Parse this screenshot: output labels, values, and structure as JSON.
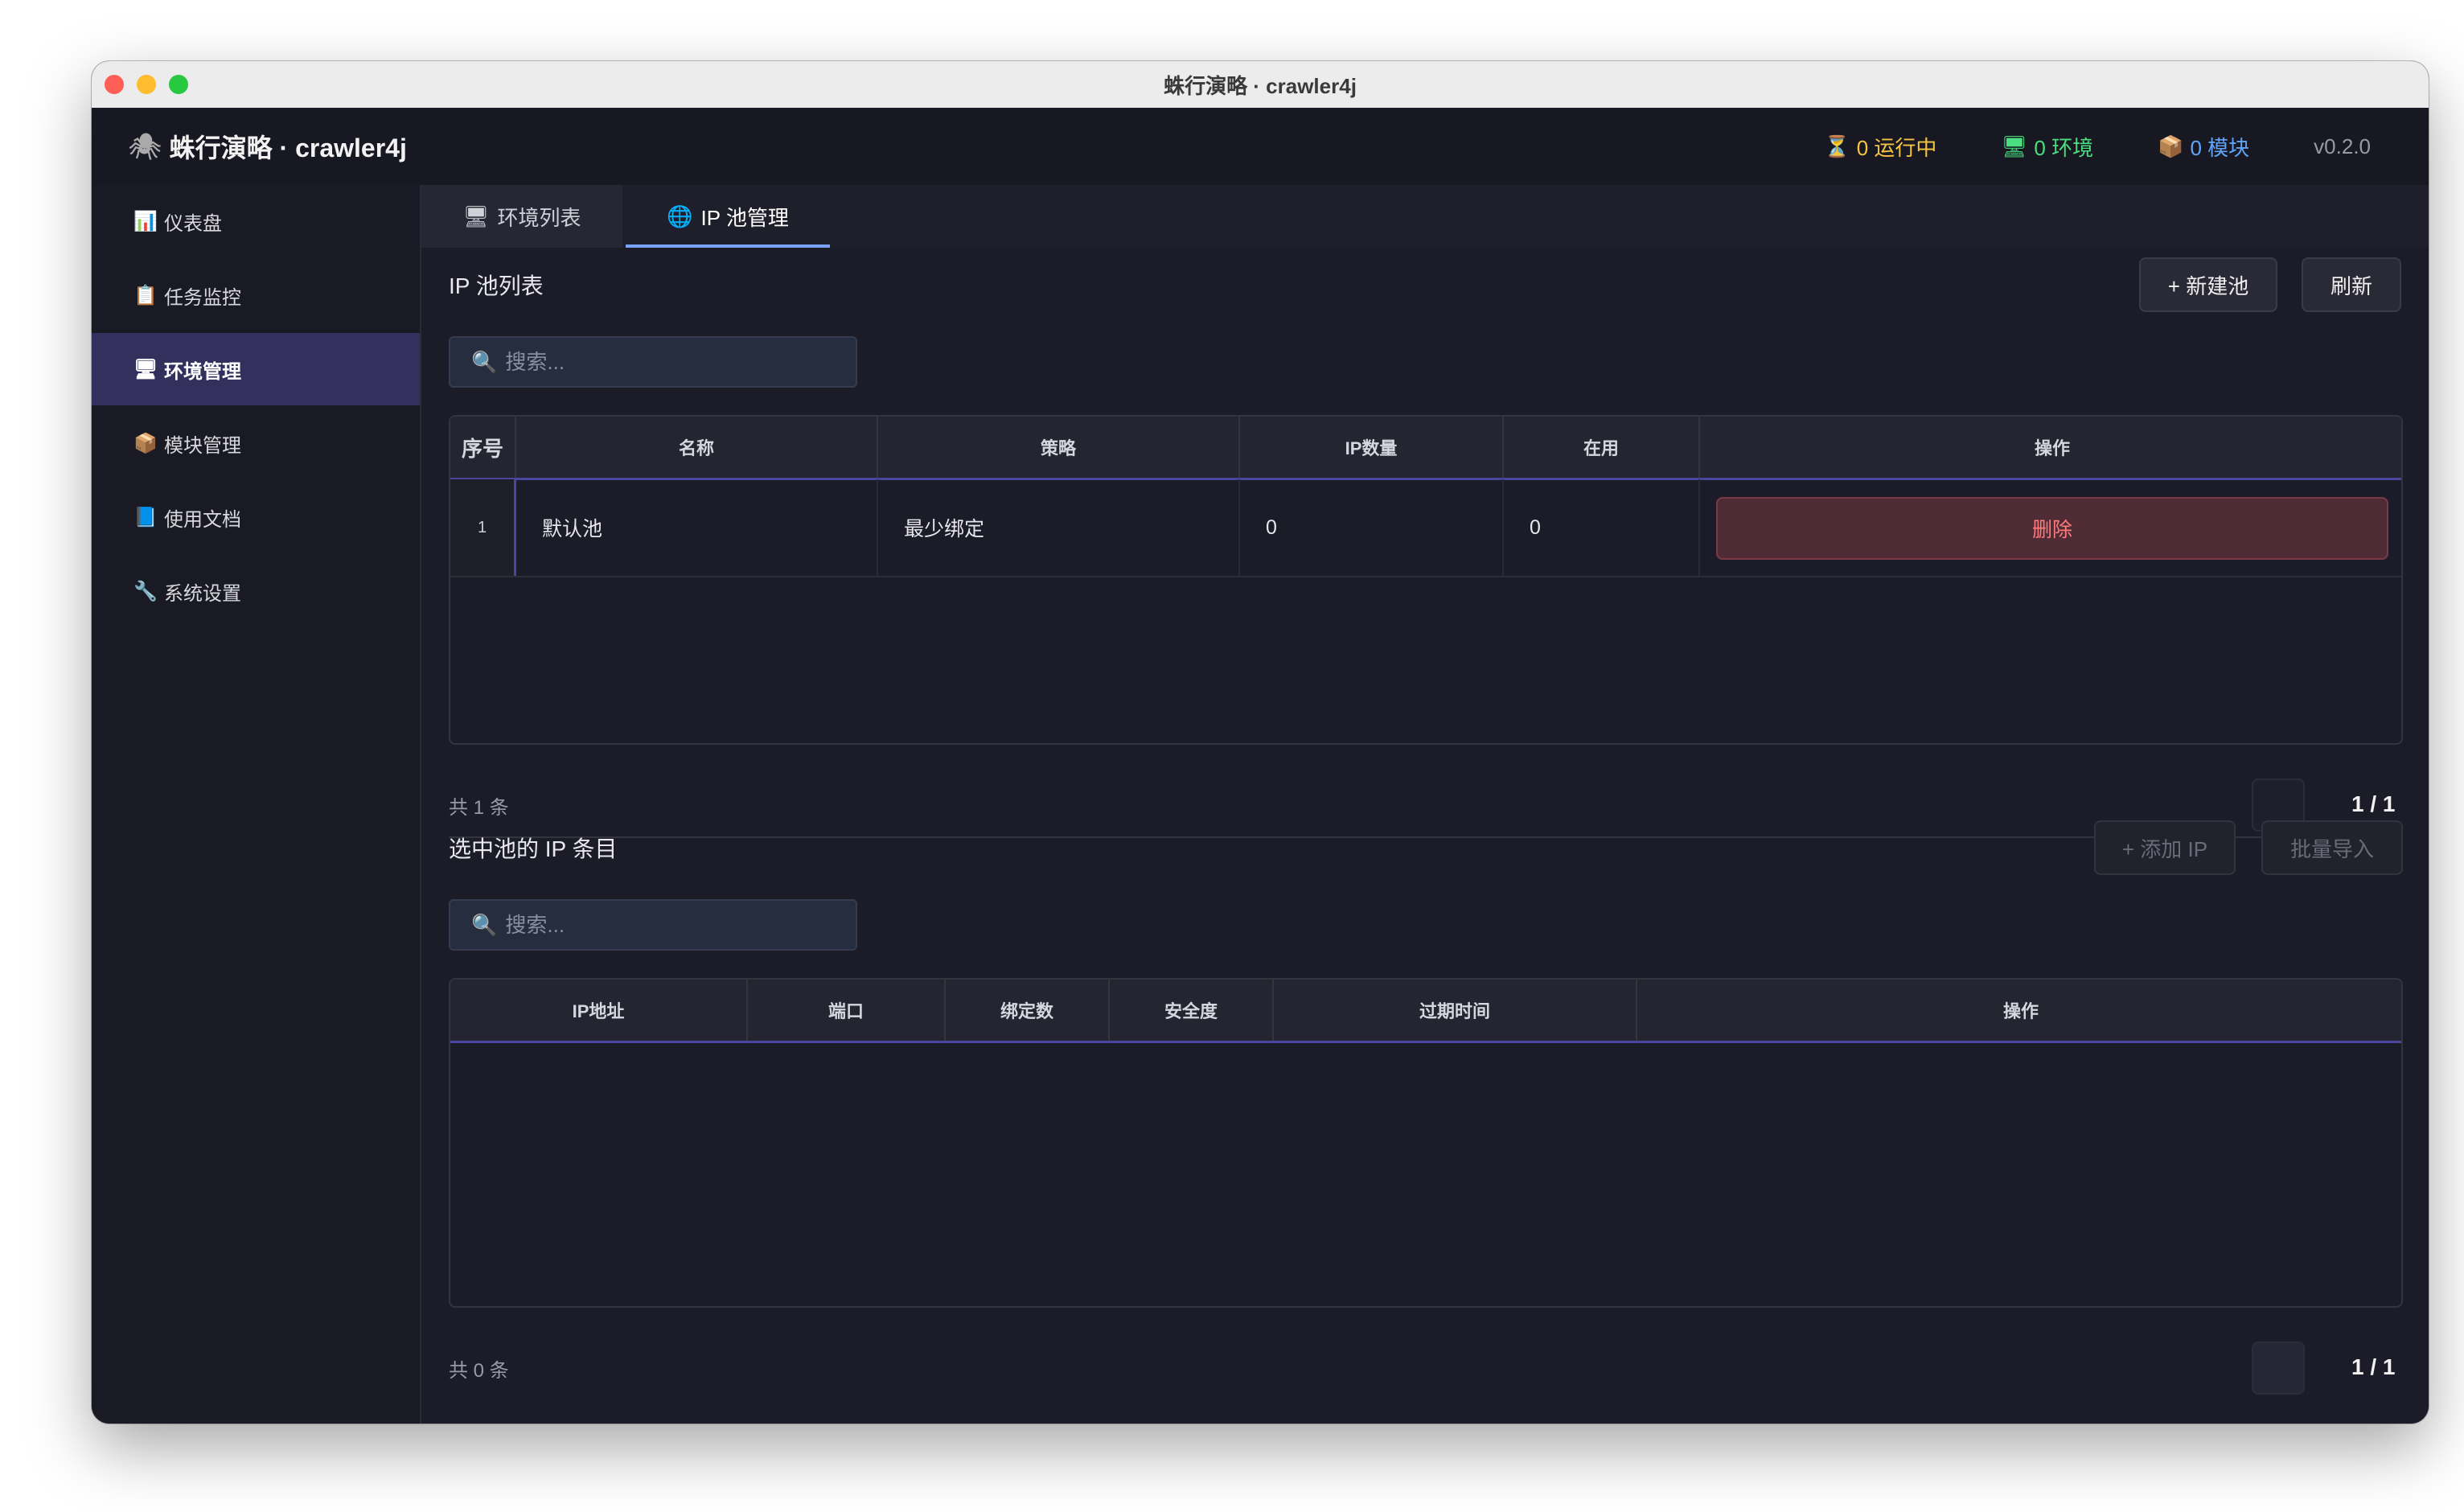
{
  "window": {
    "title": "蛛行演略 · crawler4j"
  },
  "header": {
    "brand_icon": "spider-icon",
    "brand": "蛛行演略 · crawler4j",
    "stats": [
      {
        "icon": "hourglass-icon",
        "glyph": "⏳",
        "text": "0 运行中",
        "color": "#f5c542"
      },
      {
        "icon": "monitor-icon",
        "glyph": "🖥",
        "text": "0 环境",
        "color": "#4ade80"
      },
      {
        "icon": "package-icon",
        "glyph": "📦",
        "text": "0 模块",
        "color": "#60a5fa"
      }
    ],
    "version": "v0.2.0"
  },
  "sidebar": {
    "items": [
      {
        "icon": "chart-icon",
        "glyph": "📊",
        "label": "仪表盘"
      },
      {
        "icon": "clipboard-icon",
        "glyph": "📋",
        "label": "任务监控"
      },
      {
        "icon": "monitor-icon",
        "glyph": "🖥",
        "label": "环境管理",
        "active": true
      },
      {
        "icon": "package-icon",
        "glyph": "📦",
        "label": "模块管理"
      },
      {
        "icon": "book-icon",
        "glyph": "📘",
        "label": "使用文档"
      },
      {
        "icon": "wrench-icon",
        "glyph": "🔧",
        "label": "系统设置"
      }
    ]
  },
  "tabs": [
    {
      "icon": "monitor-icon",
      "glyph": "🖥",
      "label": "环境列表"
    },
    {
      "icon": "globe-icon",
      "glyph": "🌐",
      "label": "IP 池管理",
      "active": true
    }
  ],
  "pool_section": {
    "title": "IP 池列表",
    "new_button": "+ 新建池",
    "refresh_button": "刷新",
    "search_placeholder": "搜索...",
    "columns": [
      "序号",
      "名称",
      "策略",
      "IP数量",
      "在用",
      "操作"
    ],
    "rows": [
      {
        "index": "1",
        "name": "默认池",
        "strategy": "最少绑定",
        "ip_count": "0",
        "in_use": "0",
        "action": "删除"
      }
    ],
    "count": "共 1 条",
    "page": "1 / 1"
  },
  "entry_section": {
    "title": "选中池的 IP 条目",
    "add_button": "+ 添加 IP",
    "import_button": "批量导入",
    "search_placeholder": "搜索...",
    "columns": [
      "IP地址",
      "端口",
      "绑定数",
      "安全度",
      "过期时间",
      "操作"
    ],
    "count": "共 0 条",
    "page": "1 / 1"
  }
}
